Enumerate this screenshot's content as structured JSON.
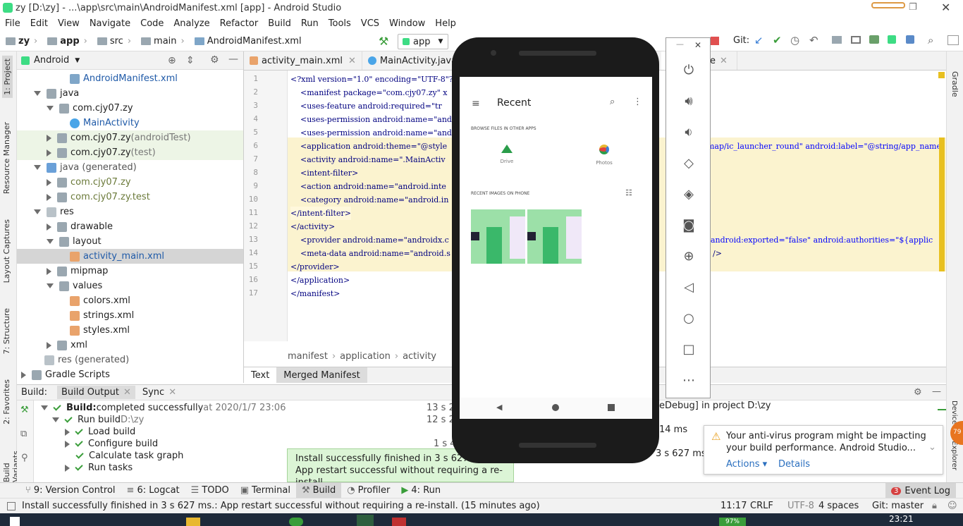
{
  "window": {
    "title": "zy [D:\\zy] - ...\\app\\src\\main\\AndroidManifest.xml [app] - Android Studio"
  },
  "menu": [
    "File",
    "Edit",
    "View",
    "Navigate",
    "Code",
    "Analyze",
    "Refactor",
    "Build",
    "Run",
    "Tools",
    "VCS",
    "Window",
    "Help"
  ],
  "nav": {
    "crumbs": [
      "zy",
      "app",
      "src",
      "main",
      "AndroidManifest.xml"
    ],
    "run_config": "app",
    "git_label": "Git:"
  },
  "left_tabs": [
    "1: Project",
    "Resource Manager",
    "Layout Captures",
    "7: Structure",
    "2: Favorites",
    "Build Variants"
  ],
  "right_tabs": [
    "Gradle",
    "Device File Explorer"
  ],
  "project": {
    "view": "Android",
    "tree": [
      {
        "label": "AndroidManifest.xml",
        "icon": "mf",
        "indent": 3,
        "arrow": ""
      },
      {
        "label": "java",
        "icon": "fold",
        "indent": 1,
        "arrow": "down"
      },
      {
        "label": "com.cjy07.zy",
        "icon": "fold",
        "indent": 2,
        "arrow": "down"
      },
      {
        "label": "MainActivity",
        "icon": "cls",
        "indent": 3,
        "arrow": ""
      },
      {
        "label": "com.cjy07.zy",
        "suffix": " (androidTest)",
        "icon": "fold",
        "indent": 2,
        "arrow": "right"
      },
      {
        "label": "com.cjy07.zy",
        "suffix": " (test)",
        "icon": "fold",
        "indent": 2,
        "arrow": "right"
      },
      {
        "label": "java (generated)",
        "icon": "java",
        "indent": 1,
        "arrow": "down"
      },
      {
        "label": "com.cjy07.zy",
        "icon": "fold",
        "indent": 2,
        "arrow": "right"
      },
      {
        "label": "com.cjy07.zy.test",
        "icon": "fold",
        "indent": 2,
        "arrow": "right"
      },
      {
        "label": "res",
        "icon": "res",
        "indent": 1,
        "arrow": "down"
      },
      {
        "label": "drawable",
        "icon": "fold",
        "indent": 2,
        "arrow": "right"
      },
      {
        "label": "layout",
        "icon": "fold",
        "indent": 2,
        "arrow": "down"
      },
      {
        "label": "activity_main.xml",
        "icon": "xml",
        "indent": 3,
        "arrow": ""
      },
      {
        "label": "mipmap",
        "icon": "fold",
        "indent": 2,
        "arrow": "right"
      },
      {
        "label": "values",
        "icon": "fold",
        "indent": 2,
        "arrow": "down"
      },
      {
        "label": "colors.xml",
        "icon": "xml",
        "indent": 3,
        "arrow": ""
      },
      {
        "label": "strings.xml",
        "icon": "xml",
        "indent": 3,
        "arrow": ""
      },
      {
        "label": "styles.xml",
        "icon": "xml",
        "indent": 3,
        "arrow": ""
      },
      {
        "label": "xml",
        "icon": "fold",
        "indent": 2,
        "arrow": "right"
      },
      {
        "label": "res (generated)",
        "icon": "res",
        "indent": 1,
        "arrow": ""
      },
      {
        "label": "Gradle Scripts",
        "icon": "fold",
        "indent": 0,
        "arrow": "right"
      }
    ]
  },
  "editor": {
    "tabs": [
      "activity_main.xml",
      "MainActivity.java",
      "a",
      "ore"
    ],
    "lines": [
      "<?xml version=\"1.0\" encoding=\"UTF-8\"?>",
      "    <manifest package=\"com.cjy07.zy\" x",
      "    <uses-feature android:required=\"tr",
      "    <uses-permission android:name=\"and",
      "    <uses-permission android:name=\"and",
      "    <application android:theme=\"@style",
      "    <activity android:name=\".MainActiv",
      "    <intent-filter>",
      "    <action android:name=\"android.inte",
      "    <category android:name=\"android.in",
      "</intent-filter>",
      "</activity>",
      "    <provider android:name=\"androidx.c",
      "    <meta-data android:name=\"android.s",
      "</provider>",
      "</application>",
      "</manifest>"
    ],
    "right_fragments": {
      "l6": "map/ic_launcher_round\" android:label=\"@string/app_name",
      "l13": "android:exported=\"false\" android:authorities=\"${applic",
      "l14": "/>"
    },
    "crumbs": [
      "manifest",
      "application",
      "activity"
    ],
    "bottom_tabs": [
      "Text",
      "Merged Manifest"
    ]
  },
  "build": {
    "tabs": [
      "Build:",
      "Build Output",
      "Sync"
    ],
    "rows": [
      {
        "bold": "Build:",
        "text": " completed successfully",
        "extra": " at 2020/1/7 23:06",
        "time": "13 s 2"
      },
      {
        "text": "Run build",
        "extra": " D:\\zy",
        "time": "12 s 2"
      },
      {
        "text": "Load build",
        "time": ""
      },
      {
        "text": "Configure build",
        "time": "1 s 4"
      },
      {
        "text": "Calculate task graph",
        "time": ""
      },
      {
        "text": "Run tasks",
        "time": ""
      }
    ],
    "right_text": "eDebug] in project D:\\zy",
    "right_ms1": "14 ms",
    "right_ms2": "3 s 627 ms"
  },
  "toast": [
    "Install successfully finished in 3 s 627 ms.",
    "App restart successful without requiring a re-install."
  ],
  "notification": {
    "text": "Your anti-virus program might be impacting your build performance. Android Studio...",
    "actions": "Actions",
    "details": "Details"
  },
  "tool_windows": [
    "9: Version Control",
    "6: Logcat",
    "TODO",
    "Terminal",
    "Build",
    "Profiler",
    "4: Run"
  ],
  "event_log": {
    "count": "3",
    "label": "Event Log"
  },
  "status": {
    "message": "Install successfully finished in 3 s 627 ms.: App restart successful without requiring a re-install. (15 minutes ago)",
    "pos": "11:17",
    "eol": "CRLF",
    "enc": "UTF-8",
    "indent": "4 spaces",
    "git": "Git: master"
  },
  "taskbar": {
    "time": "23:21",
    "battery": "97%"
  },
  "phone": {
    "title": "Recent",
    "browse_header": "BROWSE FILES IN OTHER APPS",
    "apps": [
      "Drive",
      "Photos"
    ],
    "recent_header": "RECENT IMAGES ON PHONE"
  },
  "emulator_side": {
    "icons": [
      "power-icon",
      "volume-up-icon",
      "volume-down-icon",
      "rotate-left-icon",
      "rotate-right-icon",
      "camera-icon",
      "zoom-icon",
      "back-icon",
      "home-icon",
      "overview-icon",
      "more-icon"
    ]
  }
}
